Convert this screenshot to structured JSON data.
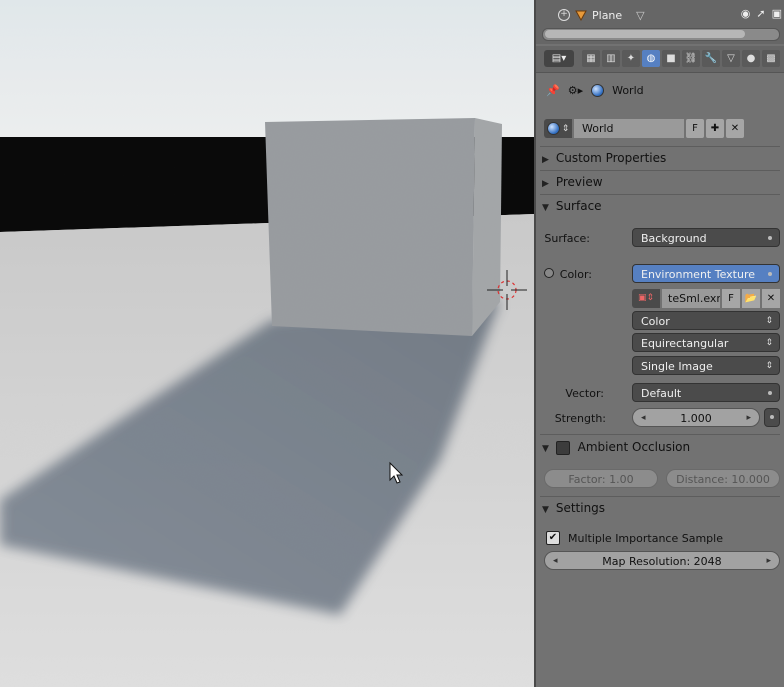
{
  "outliner": {
    "object_name": "Plane"
  },
  "breadcrumb": {
    "world_label": "World"
  },
  "datablock": {
    "name": "World",
    "fake_user_label": "F"
  },
  "sections": {
    "custom_properties": "Custom Properties",
    "preview": "Preview",
    "surface": "Surface",
    "ambient_occlusion": "Ambient Occlusion",
    "settings": "Settings"
  },
  "surface": {
    "surface_label": "Surface:",
    "surface_value": "Background",
    "color_label": "Color:",
    "color_value": "Environment Texture",
    "image_name": "teSml.exr",
    "image_fake_user": "F",
    "color_space": "Color",
    "projection": "Equirectangular",
    "source": "Single Image",
    "vector_label": "Vector:",
    "vector_value": "Default",
    "strength_label": "Strength:",
    "strength_value": "1.000"
  },
  "ambient_occlusion": {
    "factor": "Factor: 1.00",
    "distance": "Distance: 10.000"
  },
  "settings": {
    "mis_label": "Multiple Importance Sample",
    "map_resolution": "Map Resolution: 2048"
  },
  "colors": {
    "accent": "#5680c2",
    "panel_bg": "#727272",
    "field_dark": "#4b4b4b"
  }
}
